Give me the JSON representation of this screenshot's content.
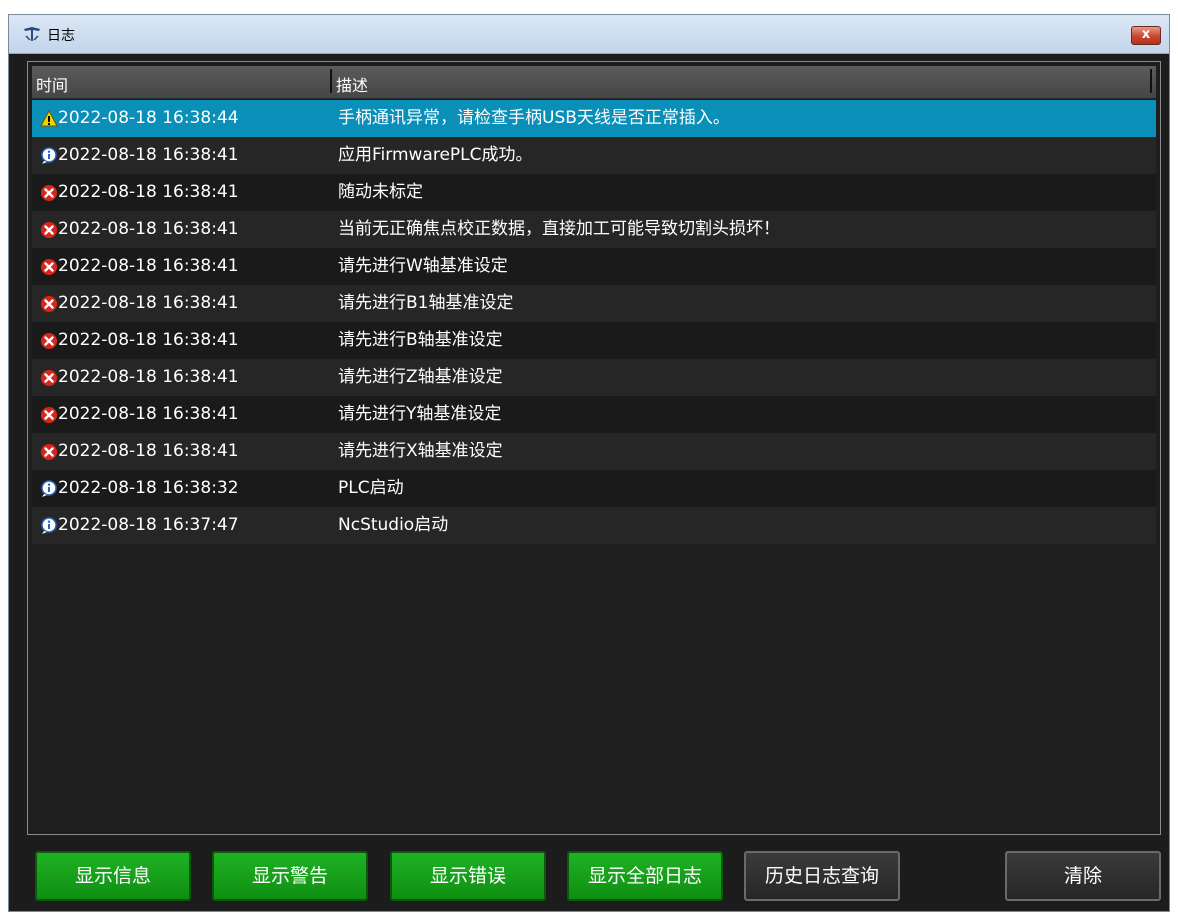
{
  "window": {
    "title": "日志",
    "close_label": "x"
  },
  "table": {
    "columns": [
      "时间",
      "描述"
    ],
    "rows": [
      {
        "type": "warning",
        "time": "2022-08-18 16:38:44",
        "desc": "手柄通讯异常，请检查手柄USB天线是否正常插入。"
      },
      {
        "type": "info",
        "time": "2022-08-18 16:38:41",
        "desc": "应用FirmwarePLC成功。"
      },
      {
        "type": "error",
        "time": "2022-08-18 16:38:41",
        "desc": "随动未标定"
      },
      {
        "type": "error",
        "time": "2022-08-18 16:38:41",
        "desc": "当前无正确焦点校正数据，直接加工可能导致切割头损坏！"
      },
      {
        "type": "error",
        "time": "2022-08-18 16:38:41",
        "desc": "请先进行W轴基准设定"
      },
      {
        "type": "error",
        "time": "2022-08-18 16:38:41",
        "desc": "请先进行B1轴基准设定"
      },
      {
        "type": "error",
        "time": "2022-08-18 16:38:41",
        "desc": "请先进行B轴基准设定"
      },
      {
        "type": "error",
        "time": "2022-08-18 16:38:41",
        "desc": "请先进行Z轴基准设定"
      },
      {
        "type": "error",
        "time": "2022-08-18 16:38:41",
        "desc": "请先进行Y轴基准设定"
      },
      {
        "type": "error",
        "time": "2022-08-18 16:38:41",
        "desc": "请先进行X轴基准设定"
      },
      {
        "type": "info",
        "time": "2022-08-18 16:38:32",
        "desc": "PLC启动"
      },
      {
        "type": "info",
        "time": "2022-08-18 16:37:47",
        "desc": "NcStudio启动"
      }
    ],
    "selected_index": 0
  },
  "buttons": {
    "show_info": "显示信息",
    "show_warning": "显示警告",
    "show_error": "显示错误",
    "show_all": "显示全部日志",
    "history": "历史日志查询",
    "clear": "清除"
  },
  "colors": {
    "selected_row": "#0a8fb8",
    "button_green": "#1fb224",
    "error_icon": "#d9261c",
    "warning_icon": "#f5d300",
    "info_icon": "#2a63b8"
  },
  "icons": {
    "warning": "warning-icon",
    "info": "info-icon",
    "error": "error-icon"
  }
}
